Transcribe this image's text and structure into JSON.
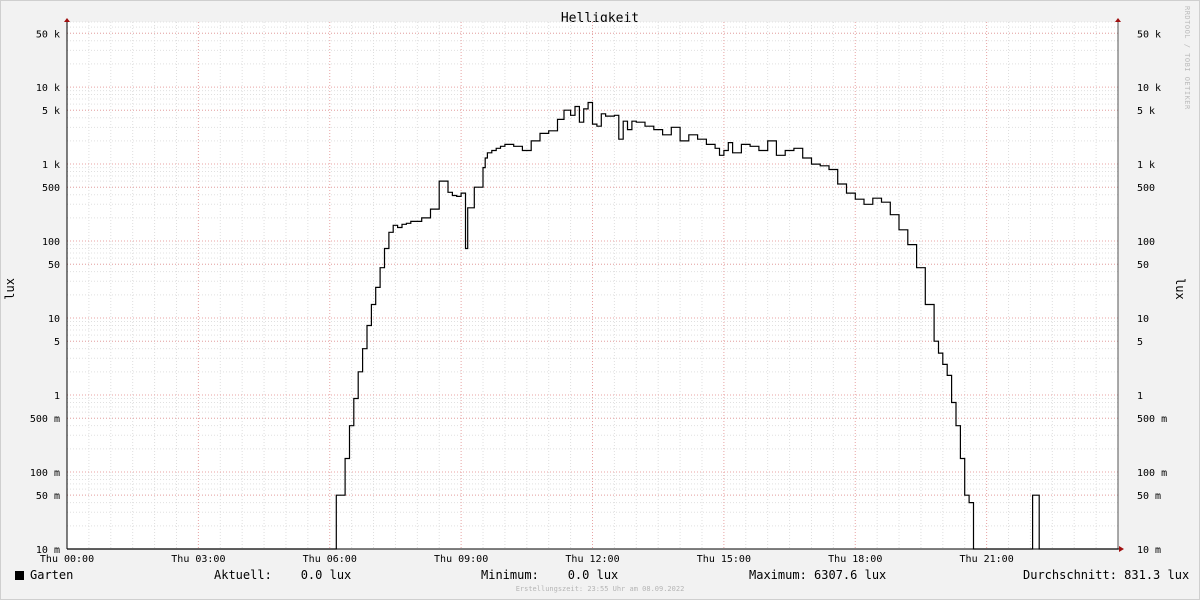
{
  "chart_data": {
    "type": "line",
    "title": "Helligkeit",
    "ylabel": "lux",
    "yscale": "log",
    "ylim": [
      0.01,
      70000
    ],
    "xlim_hours": [
      0,
      24
    ],
    "grid": true,
    "x_tick_labels": [
      "Thu 00:00",
      "Thu 03:00",
      "Thu 06:00",
      "Thu 09:00",
      "Thu 12:00",
      "Thu 15:00",
      "Thu 18:00",
      "Thu 21:00"
    ],
    "y_tick_labels": [
      {
        "value": 50000,
        "label": "50 k"
      },
      {
        "value": 10000,
        "label": "10 k"
      },
      {
        "value": 5000,
        "label": "5 k"
      },
      {
        "value": 1000,
        "label": "1 k"
      },
      {
        "value": 500,
        "label": "500"
      },
      {
        "value": 100,
        "label": "100"
      },
      {
        "value": 50,
        "label": "50"
      },
      {
        "value": 10,
        "label": "10"
      },
      {
        "value": 5,
        "label": "5"
      },
      {
        "value": 1,
        "label": "1"
      },
      {
        "value": 0.5,
        "label": "500 m"
      },
      {
        "value": 0.1,
        "label": "100 m"
      },
      {
        "value": 0.05,
        "label": "50 m"
      },
      {
        "value": 0.01,
        "label": "10 m"
      }
    ],
    "series": [
      {
        "name": "Garten",
        "color": "#000000",
        "x_hours": [
          0,
          6.15,
          6.35,
          6.45,
          6.55,
          6.65,
          6.75,
          6.85,
          6.95,
          7.05,
          7.15,
          7.25,
          7.35,
          7.45,
          7.55,
          7.65,
          7.75,
          7.85,
          7.95,
          8.1,
          8.3,
          8.5,
          8.7,
          8.8,
          8.9,
          9.0,
          9.1,
          9.15,
          9.3,
          9.5,
          9.55,
          9.6,
          9.7,
          9.8,
          9.9,
          10.0,
          10.2,
          10.4,
          10.6,
          10.8,
          11.0,
          11.2,
          11.35,
          11.5,
          11.6,
          11.7,
          11.8,
          11.9,
          12.0,
          12.1,
          12.2,
          12.3,
          12.4,
          12.5,
          12.6,
          12.7,
          12.8,
          12.9,
          13.0,
          13.2,
          13.4,
          13.6,
          13.8,
          14.0,
          14.2,
          14.4,
          14.6,
          14.8,
          14.9,
          15.0,
          15.1,
          15.2,
          15.4,
          15.6,
          15.8,
          16.0,
          16.2,
          16.4,
          16.6,
          16.8,
          17.0,
          17.2,
          17.3,
          17.4,
          17.6,
          17.8,
          18.0,
          18.2,
          18.4,
          18.6,
          18.8,
          19.0,
          19.2,
          19.4,
          19.6,
          19.8,
          19.9,
          20.0,
          20.1,
          20.2,
          20.3,
          20.4,
          20.5,
          20.6,
          20.7,
          20.8,
          20.9,
          21.0,
          21.15,
          21.3,
          21.5,
          22.0,
          22.05,
          22.1,
          22.2,
          24.0
        ],
        "y_lux": [
          0.01,
          0.05,
          0.15,
          0.4,
          0.9,
          2,
          4,
          8,
          15,
          25,
          45,
          80,
          130,
          160,
          150,
          165,
          170,
          180,
          180,
          200,
          260,
          600,
          430,
          390,
          380,
          420,
          80,
          270,
          500,
          900,
          1200,
          1400,
          1500,
          1600,
          1700,
          1800,
          1700,
          1500,
          2000,
          2500,
          2700,
          3800,
          5000,
          4300,
          5600,
          3500,
          5200,
          6300,
          3300,
          3100,
          4500,
          4200,
          4200,
          4300,
          2100,
          3600,
          2800,
          3600,
          3500,
          3100,
          2800,
          2400,
          3000,
          2000,
          2400,
          2100,
          1800,
          1600,
          1300,
          1500,
          1900,
          1400,
          1800,
          1700,
          1500,
          2000,
          1300,
          1500,
          1600,
          1200,
          1000,
          950,
          950,
          850,
          550,
          420,
          350,
          300,
          360,
          320,
          220,
          140,
          90,
          45,
          15,
          5,
          3.5,
          2.5,
          1.8,
          0.8,
          0.4,
          0.15,
          0.05,
          0.04,
          0.01,
          0.01,
          0.01,
          0.01,
          0.01,
          0.01,
          0.01,
          0.01,
          0.05,
          0.05,
          0.01,
          0.01
        ]
      }
    ]
  },
  "legend": {
    "series_name": "Garten",
    "aktuell": "Aktuell:    0.0 lux",
    "minimum": "Minimum:    0.0 lux",
    "maximum": "Maximum: 6307.6 lux",
    "durchschnitt": "Durchschnitt: 831.3 lux"
  },
  "watermark": "RRDTOOL / TOBI OETIKER",
  "footer": "Erstellungszeit: 23:55 Uhr am 08.09.2022"
}
